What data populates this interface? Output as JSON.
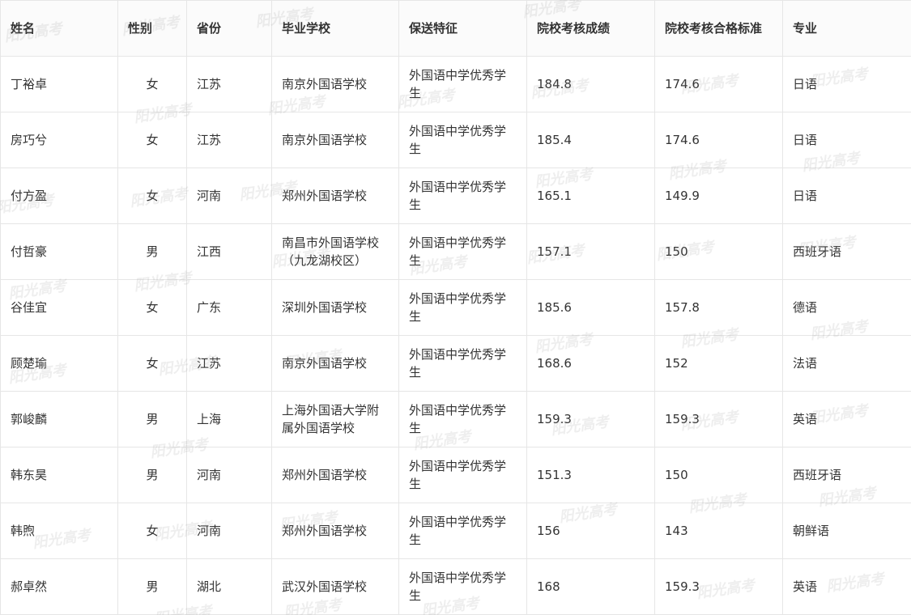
{
  "table": {
    "headers": [
      "姓名",
      "性别",
      "省份",
      "毕业学校",
      "保送特征",
      "院校考核成绩",
      "院校考核合格标准",
      "专业"
    ],
    "rows": [
      [
        "丁裕卓",
        "女",
        "江苏",
        "南京外国语学校",
        "外国语中学优秀学生",
        "184.8",
        "174.6",
        "日语"
      ],
      [
        "房巧兮",
        "女",
        "江苏",
        "南京外国语学校",
        "外国语中学优秀学生",
        "185.4",
        "174.6",
        "日语"
      ],
      [
        "付方盈",
        "女",
        "河南",
        "郑州外国语学校",
        "外国语中学优秀学生",
        "165.1",
        "149.9",
        "日语"
      ],
      [
        "付哲豪",
        "男",
        "江西",
        "南昌市外国语学校（九龙湖校区）",
        "外国语中学优秀学生",
        "157.1",
        "150",
        "西班牙语"
      ],
      [
        "谷佳宜",
        "女",
        "广东",
        "深圳外国语学校",
        "外国语中学优秀学生",
        "185.6",
        "157.8",
        "德语"
      ],
      [
        "顾楚瑜",
        "女",
        "江苏",
        "南京外国语学校",
        "外国语中学优秀学生",
        "168.6",
        "152",
        "法语"
      ],
      [
        "郭峻麟",
        "男",
        "上海",
        "上海外国语大学附属外国语学校",
        "外国语中学优秀学生",
        "159.3",
        "159.3",
        "英语"
      ],
      [
        "韩东昊",
        "男",
        "河南",
        "郑州外国语学校",
        "外国语中学优秀学生",
        "151.3",
        "150",
        "西班牙语"
      ],
      [
        "韩煦",
        "女",
        "河南",
        "郑州外国语学校",
        "外国语中学优秀学生",
        "156",
        "143",
        "朝鲜语"
      ],
      [
        "郝卓然",
        "男",
        "湖北",
        "武汉外国语学校",
        "外国语中学优秀学生",
        "168",
        "159.3",
        "英语"
      ]
    ]
  },
  "watermark": {
    "text": "阳光高考"
  }
}
